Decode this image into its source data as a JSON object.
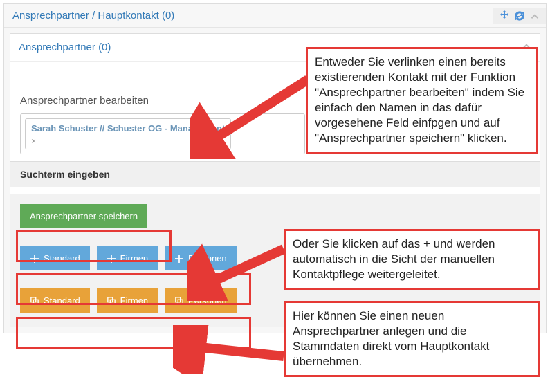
{
  "panel": {
    "title": "Ansprechpartner / Hauptkontakt (0)"
  },
  "subpanel": {
    "title": "Ansprechpartner (0)"
  },
  "edit": {
    "label": "Ansprechpartner bearbeiten",
    "tag": "Sarah Schuster // Schuster OG - Management",
    "tag_remove": "×",
    "searchterm": "Suchterm eingeben"
  },
  "buttons": {
    "save": "Ansprechpartner speichern",
    "plus_standard": "Standard",
    "plus_firmen": "Firmen",
    "plus_personen": "Personen",
    "copy_standard": "Standard",
    "copy_firmen": "Firmen",
    "copy_personen": "Personen"
  },
  "callouts": {
    "c1": "Entweder Sie verlinken einen bereits existierenden Kontakt mit der Funktion \"Ansprechpartner bearbeiten\" indem Sie einfach den Namen in das dafür vorgesehene Feld einfpgen und auf \"Ansprechpartner speichern\" klicken.",
    "c2": "Oder Sie klicken auf das + und werden automatisch in die Sicht der manuellen Kontaktpflege weitergeleitet.",
    "c3": "Hier können Sie einen neuen Ansprechpartner anlegen und die Stammdaten direkt vom Hauptkontakt übernehmen."
  }
}
